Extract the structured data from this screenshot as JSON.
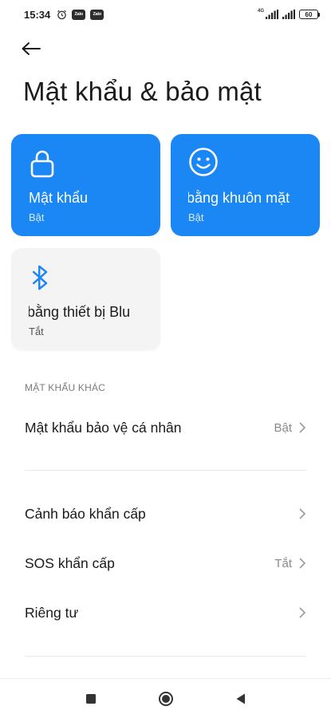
{
  "status_bar": {
    "time": "15:34",
    "app_badges": [
      "Zalo",
      "Zalo"
    ],
    "network_label": "4G",
    "battery": "60"
  },
  "header": {
    "title": "Mật khẩu & bảo mật"
  },
  "tiles": [
    {
      "label": "Mật khẩu",
      "status": "Bật",
      "icon": "lock-icon",
      "active": true
    },
    {
      "label": "bằng khuôn mặt",
      "status": "Bật",
      "icon": "face-icon",
      "active": true
    },
    {
      "label": "bằng thiết bị Blu",
      "status": "Tắt",
      "icon": "bluetooth-icon",
      "active": false
    }
  ],
  "section": {
    "header": "MẬT KHẨU KHÁC"
  },
  "rows": [
    {
      "label": "Mật khẩu bảo vệ cá nhân",
      "value": "Bật"
    },
    {
      "label": "Cảnh báo khẩn cấp",
      "value": ""
    },
    {
      "label": "SOS khẩn cấp",
      "value": "Tắt"
    },
    {
      "label": "Riêng tư",
      "value": ""
    }
  ],
  "colors": {
    "accent": "#1a87f5",
    "tile_inactive": "#f4f4f4",
    "bluetooth_icon": "#1a87f5"
  }
}
